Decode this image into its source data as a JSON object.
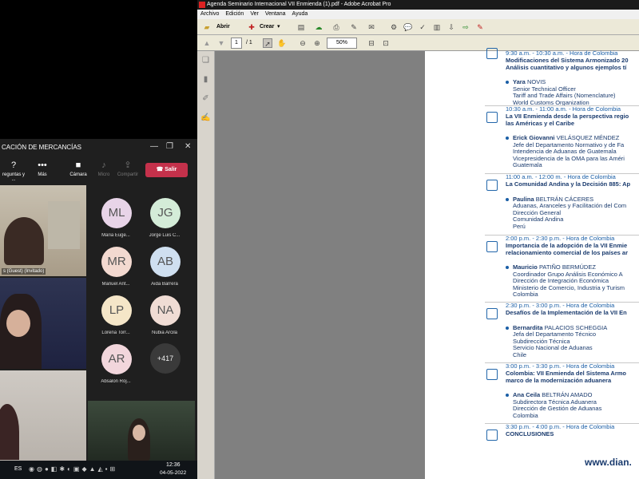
{
  "teams": {
    "title": "CACIÓN DE MERCANCÍAS",
    "toolbar": {
      "items": [
        {
          "label": "reguntas y ..."
        },
        {
          "label": "Más"
        },
        {
          "label": "Cámara"
        },
        {
          "label": "Micro"
        },
        {
          "label": "Compartir"
        }
      ],
      "leave_label": "Salir"
    },
    "tiles": [
      {
        "label": "s (Guest) (Invitado)"
      },
      {
        "label": ""
      },
      {
        "label": ""
      },
      {
        "label": ""
      }
    ],
    "participants": [
      {
        "initials": "ML",
        "name": "Maria Euge...",
        "color": "#e8d4e8"
      },
      {
        "initials": "JG",
        "name": "Jorge Luis C...",
        "color": "#d4ecd8"
      },
      {
        "initials": "MR",
        "name": "Manuel Ant...",
        "color": "#f3d9d0"
      },
      {
        "initials": "AB",
        "name": "Aida Barrera",
        "color": "#cfdff0"
      },
      {
        "initials": "LP",
        "name": "Lorena Torr...",
        "color": "#f5e6c8"
      },
      {
        "initials": "NA",
        "name": "Nubia Arcila",
        "color": "#f0dcd4"
      },
      {
        "initials": "AR",
        "name": "Absalon Roj...",
        "color": "#f2d6dc"
      }
    ],
    "more_count": "+417"
  },
  "taskbar": {
    "lang": "ES",
    "time": "12:36",
    "date": "04-05-2022"
  },
  "acrobat": {
    "window_title": "Agenda Seminario Internacional VII Enmienda (1).pdf - Adobe Acrobat Pro",
    "menu": [
      "Archivo",
      "Edición",
      "Ver",
      "Ventana",
      "Ayuda"
    ],
    "open_label": "Abrir",
    "create_label": "Crear",
    "page_current": "1",
    "page_total": "/ 1",
    "zoom": "50%"
  },
  "agenda": [
    {
      "time": "9:30 a.m. - 10:30 a.m. - Hora de Colombia",
      "title": [
        "Modificaciones del Sistema Armonizado 20",
        "Análisis cuantitativo y algunos ejemplos tí"
      ],
      "speaker_first": "Yara",
      "speaker_last": "NOVIS",
      "lines": [
        "Senior Technical Officer",
        "Tariff and Trade Affairs (Nomenclature)",
        "World Customs Organization"
      ]
    },
    {
      "time": "10:30 a.m. - 11:00 a.m. - Hora de Colombia",
      "title": [
        "La VII Enmienda desde la perspectiva regio",
        "las Américas y el Caribe"
      ],
      "speaker_first": "Erick Giovanni",
      "speaker_last": "VELÁSQUEZ MÉNDEZ",
      "lines": [
        "Jefe del Departamento Normativo y de Fa",
        "Intendencia de Aduanas de Guatemala",
        "Vicepresidencia de la OMA para las Améri",
        "Guatemala"
      ]
    },
    {
      "time": "11:00 a.m. - 12:00 m. - Hora de Colombia",
      "title": [
        "La Comunidad Andina y la Decisión 885: Ap"
      ],
      "speaker_first": "Paulina",
      "speaker_last": "BELTRÁN CÁCERES",
      "lines": [
        "Aduanas, Aranceles y Facilitación del Com",
        "Dirección General",
        "Comunidad Andina",
        "Perú"
      ]
    },
    {
      "time": "2:00 p.m. - 2:30 p.m. - Hora de Colombia",
      "title": [
        "Importancia de la adopción de la VII Enmie",
        "relacionamiento comercial de los países ar"
      ],
      "speaker_first": "Mauricio",
      "speaker_last": "PATIÑO BERMÚDEZ",
      "lines": [
        "Coordinador Grupo Análisis Económico A",
        "Dirección de Integración Económica",
        "Ministerio de Comercio, Industria y Turism",
        "Colombia"
      ]
    },
    {
      "time": "2:30 p.m. - 3:00 p.m. - Hora de Colombia",
      "title": [
        "Desafíos de la Implementación de la VII En"
      ],
      "speaker_first": "Bernardita",
      "speaker_last": "PALACIOS SCHEGGIA",
      "lines": [
        "Jefa del Departamento Técnico",
        "Subdirección Técnica",
        "Servicio Nacional de Aduanas",
        "Chile"
      ]
    },
    {
      "time": "3:00 p.m. - 3:30 p.m. - Hora de Colombia",
      "title": [
        "Colombia: VII Enmienda del Sistema Armo",
        "marco de la modernización aduanera"
      ],
      "speaker_first": "Ana Ceila",
      "speaker_last": "BELTRÁN AMADO",
      "lines": [
        "Subdirectora Técnica Aduanera",
        "Dirección de Gestión de Aduanas",
        "Colombia"
      ]
    },
    {
      "time": "3:30 p.m. - 4:00 p.m. - Hora de Colombia",
      "title": [
        "CONCLUSIONES"
      ],
      "speaker_first": "",
      "speaker_last": "",
      "lines": []
    }
  ],
  "footer_url": "www.dian."
}
